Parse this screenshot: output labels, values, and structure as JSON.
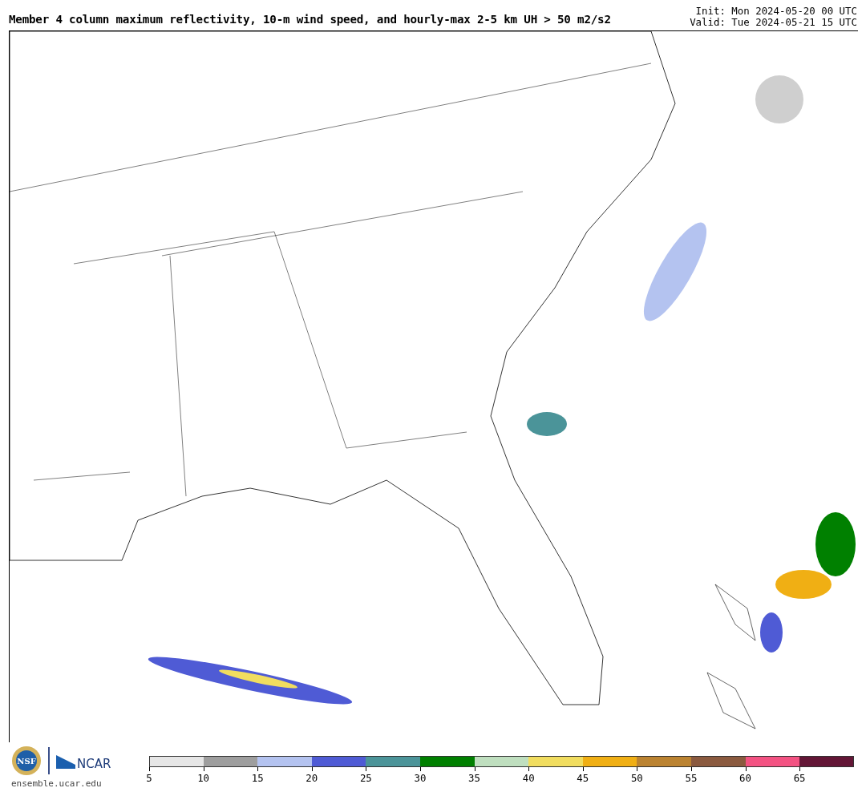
{
  "title": "Member 4 column maximum reflectivity, 10-m wind speed, and hourly-max 2-5 km UH > 50 m2/s2",
  "init": "Init: Mon 2024-05-20 00 UTC",
  "valid": "Valid: Tue 2024-05-21 15 UTC",
  "logos": {
    "nsf": "NSF",
    "ncar": "NCAR",
    "url": "ensemble.ucar.edu"
  },
  "colorbar": [
    {
      "label": "5",
      "color": "#e6e6e6"
    },
    {
      "label": "10",
      "color": "#9e9e9e"
    },
    {
      "label": "15",
      "color": "#b4c3f0"
    },
    {
      "label": "20",
      "color": "#4f5bd5"
    },
    {
      "label": "25",
      "color": "#4b9499"
    },
    {
      "label": "30",
      "color": "#008000"
    },
    {
      "label": "35",
      "color": "#bfdfbf"
    },
    {
      "label": "40",
      "color": "#f1dd5f"
    },
    {
      "label": "45",
      "color": "#f0af14"
    },
    {
      "label": "50",
      "color": "#bb8331"
    },
    {
      "label": "55",
      "color": "#8b5a3f"
    },
    {
      "label": "60",
      "color": "#f35282"
    },
    {
      "label": "65",
      "color": "#631636"
    }
  ]
}
